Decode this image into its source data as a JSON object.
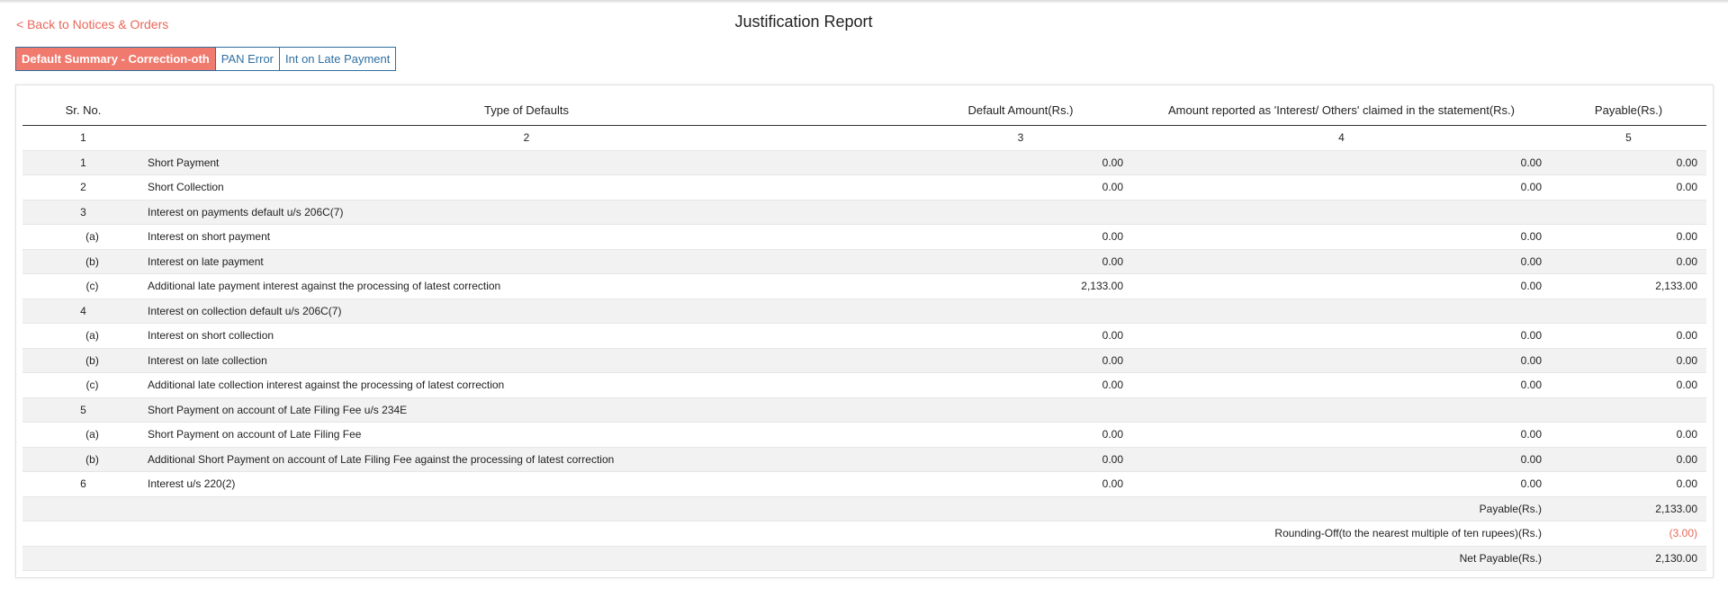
{
  "nav": {
    "back_label": "< Back to Notices & Orders"
  },
  "page_title": "Justification Report",
  "tabs": [
    {
      "label": "Default Summary - Correction-oth",
      "active": true
    },
    {
      "label": "PAN Error",
      "active": false
    },
    {
      "label": "Int on Late Payment",
      "active": false
    }
  ],
  "table": {
    "headers": [
      "Sr. No.",
      "Type of Defaults",
      "Default Amount(Rs.)",
      "Amount reported as 'Interest/ Others' claimed in the statement(Rs.)",
      "Payable(Rs.)"
    ],
    "col_numbers": [
      "1",
      "2",
      "3",
      "4",
      "5"
    ],
    "rows": [
      {
        "sr": "1",
        "type": "Short Payment",
        "c3": "0.00",
        "c4": "0.00",
        "c5": "0.00"
      },
      {
        "sr": "2",
        "type": "Short Collection",
        "c3": "0.00",
        "c4": "0.00",
        "c5": "0.00"
      },
      {
        "sr": "3",
        "type": "Interest on payments default u/s 206C(7)",
        "c3": "",
        "c4": "",
        "c5": ""
      },
      {
        "sr": "(a)",
        "type": "Interest on short payment",
        "c3": "0.00",
        "c4": "0.00",
        "c5": "0.00"
      },
      {
        "sr": "(b)",
        "type": "Interest on late payment",
        "c3": "0.00",
        "c4": "0.00",
        "c5": "0.00"
      },
      {
        "sr": "(c)",
        "type": "Additional late payment interest against the processing of latest correction",
        "c3": "2,133.00",
        "c4": "0.00",
        "c5": "2,133.00"
      },
      {
        "sr": "4",
        "type": "Interest on collection default u/s 206C(7)",
        "c3": "",
        "c4": "",
        "c5": ""
      },
      {
        "sr": "(a)",
        "type": "Interest on short collection",
        "c3": "0.00",
        "c4": "0.00",
        "c5": "0.00"
      },
      {
        "sr": "(b)",
        "type": "Interest on late collection",
        "c3": "0.00",
        "c4": "0.00",
        "c5": "0.00"
      },
      {
        "sr": "(c)",
        "type": "Additional late collection interest against the processing of latest correction",
        "c3": "0.00",
        "c4": "0.00",
        "c5": "0.00"
      },
      {
        "sr": "5",
        "type": "Short Payment on account of Late Filing Fee u/s 234E",
        "c3": "",
        "c4": "",
        "c5": ""
      },
      {
        "sr": "(a)",
        "type": "Short Payment on account of Late Filing Fee",
        "c3": "0.00",
        "c4": "0.00",
        "c5": "0.00"
      },
      {
        "sr": "(b)",
        "type": "Additional Short Payment on account of Late Filing Fee against the processing of latest correction",
        "c3": "0.00",
        "c4": "0.00",
        "c5": "0.00"
      },
      {
        "sr": "6",
        "type": "Interest u/s 220(2)",
        "c3": "0.00",
        "c4": "0.00",
        "c5": "0.00"
      }
    ],
    "totals": [
      {
        "label": "Payable(Rs.)",
        "value": "2,133.00",
        "negative": false
      },
      {
        "label": "Rounding-Off(to the nearest multiple of ten rupees)(Rs.)",
        "value": "(3.00)",
        "negative": true
      },
      {
        "label": "Net Payable(Rs.)",
        "value": "2,130.00",
        "negative": false
      }
    ]
  },
  "colors": {
    "accent": "#f07a6e",
    "link": "#e8675a",
    "tab_border": "#2f6fa0"
  }
}
